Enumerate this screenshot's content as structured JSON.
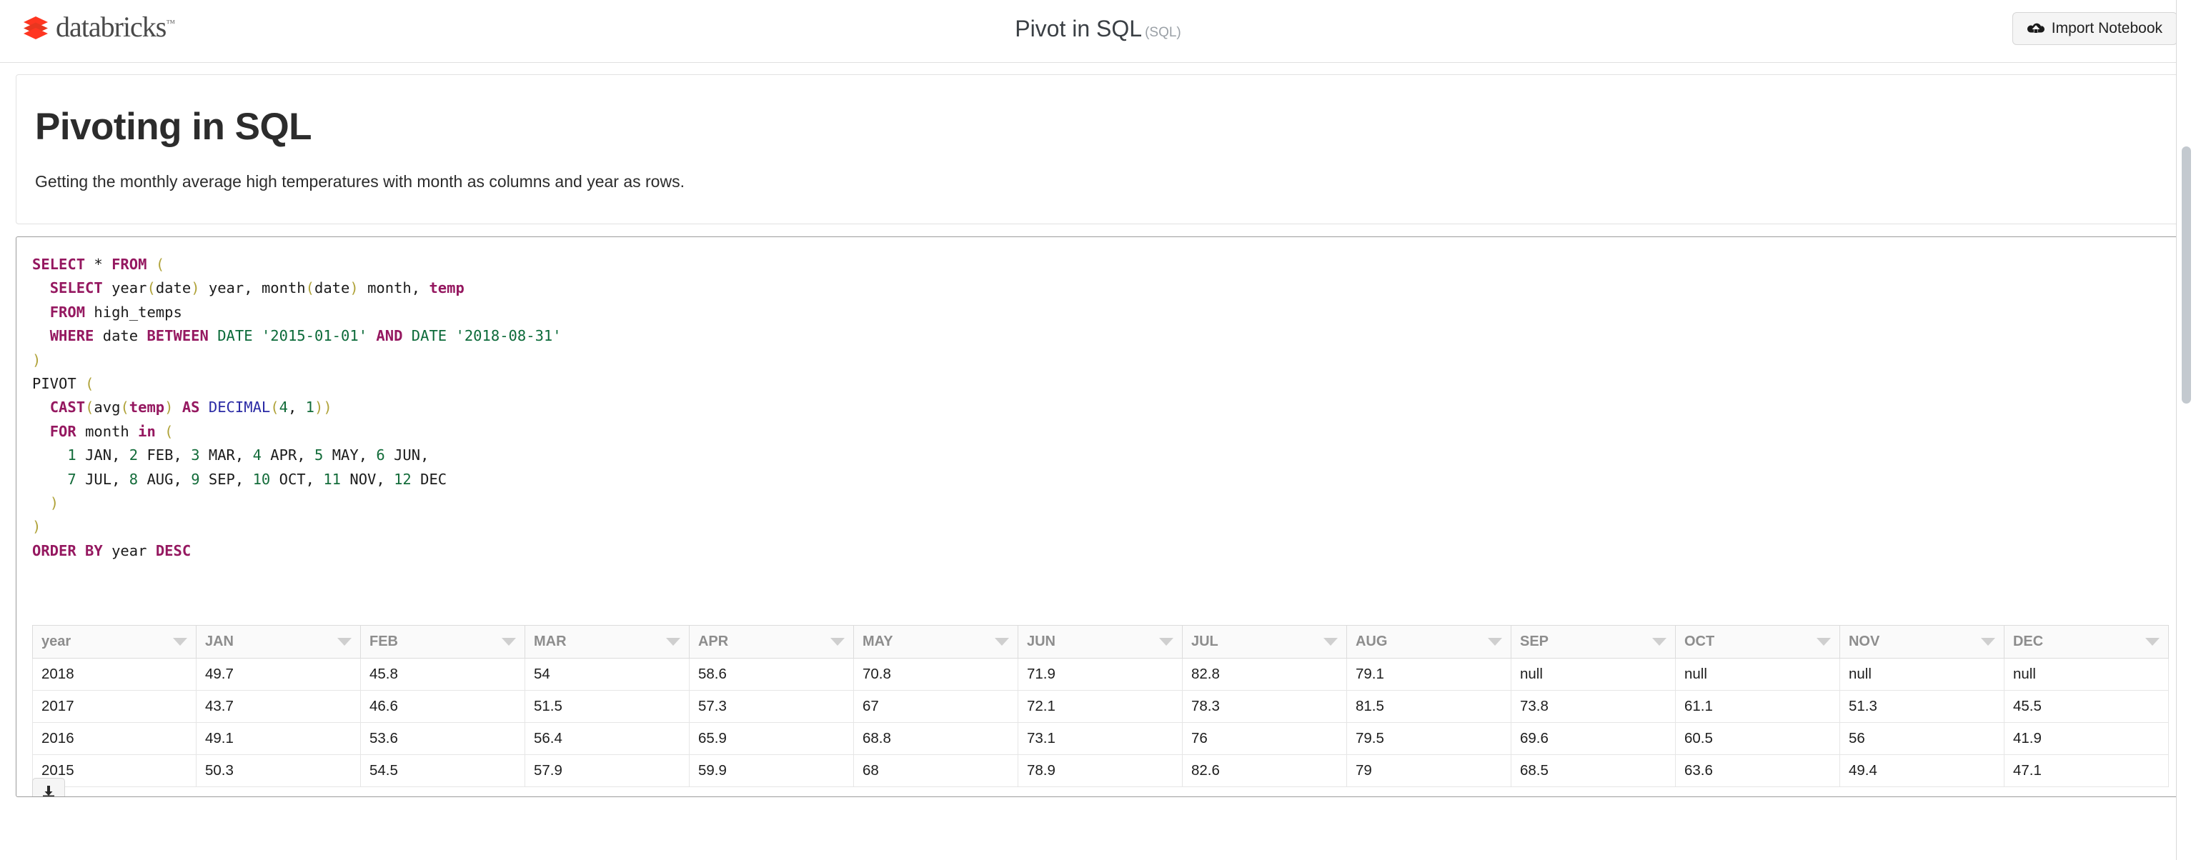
{
  "header": {
    "logo_text": "databricks",
    "logo_tm": "™",
    "notebook_title": "Pivot in SQL",
    "notebook_lang": "(SQL)",
    "import_label": "Import Notebook",
    "import_icon": "cloud-upload-icon"
  },
  "content": {
    "title": "Pivoting in SQL",
    "subtitle": "Getting the monthly average high temperatures with month as columns and year as rows."
  },
  "code": {
    "language": "sql",
    "lines": [
      "SELECT * FROM (",
      "  SELECT year(date) year, month(date) month, temp",
      "  FROM high_temps",
      "  WHERE date BETWEEN DATE '2015-01-01' AND DATE '2018-08-31'",
      ")",
      "PIVOT (",
      "  CAST(avg(temp) AS DECIMAL(4, 1))",
      "  FOR month in (",
      "    1 JAN, 2 FEB, 3 MAR, 4 APR, 5 MAY, 6 JUN,",
      "    7 JUL, 8 AUG, 9 SEP, 10 OCT, 11 NOV, 12 DEC",
      "  )",
      ")",
      "ORDER BY year DESC"
    ]
  },
  "results": {
    "columns": [
      "year",
      "JAN",
      "FEB",
      "MAR",
      "APR",
      "MAY",
      "JUN",
      "JUL",
      "AUG",
      "SEP",
      "OCT",
      "NOV",
      "DEC"
    ],
    "rows": [
      [
        "2018",
        "49.7",
        "45.8",
        "54",
        "58.6",
        "70.8",
        "71.9",
        "82.8",
        "79.1",
        "null",
        "null",
        "null",
        "null"
      ],
      [
        "2017",
        "43.7",
        "46.6",
        "51.5",
        "57.3",
        "67",
        "72.1",
        "78.3",
        "81.5",
        "73.8",
        "61.1",
        "51.3",
        "45.5"
      ],
      [
        "2016",
        "49.1",
        "53.6",
        "56.4",
        "65.9",
        "68.8",
        "73.1",
        "76",
        "79.5",
        "69.6",
        "60.5",
        "56",
        "41.9"
      ],
      [
        "2015",
        "50.3",
        "54.5",
        "57.9",
        "59.9",
        "68",
        "78.9",
        "82.6",
        "79",
        "68.5",
        "63.6",
        "49.4",
        "47.1"
      ]
    ],
    "download_icon": "download-icon"
  },
  "colors": {
    "brand_red": "#ee3d2c",
    "keyword": "#951860",
    "string": "#0b6a39",
    "number": "#136c3a",
    "paren": "#b0a33a",
    "type": "#2a2aa5",
    "header_text": "#8d8d8d"
  }
}
